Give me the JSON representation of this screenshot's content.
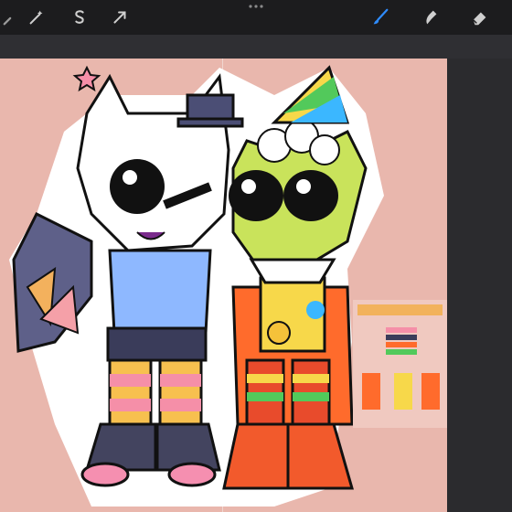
{
  "app": {
    "name": "",
    "window_title": ""
  },
  "toolbar": {
    "left_tools": [
      {
        "name": "wrench-icon"
      },
      {
        "name": "magic-wand-icon"
      },
      {
        "name": "selection-s-icon"
      },
      {
        "name": "arrow-transform-icon"
      }
    ],
    "right_tools": [
      {
        "name": "brush-icon",
        "active": true,
        "color": "#2f8cff"
      },
      {
        "name": "smudge-icon",
        "active": false
      },
      {
        "name": "eraser-icon",
        "active": false
      }
    ],
    "grip": {
      "name": "toolbar-grip-icon"
    }
  },
  "canvas": {
    "background": "#e9b7ad",
    "characters": [
      {
        "name": "white-cat-character"
      },
      {
        "name": "clown-green-character"
      }
    ],
    "reference_sheet": {
      "name": "reference-thumbnail"
    }
  }
}
